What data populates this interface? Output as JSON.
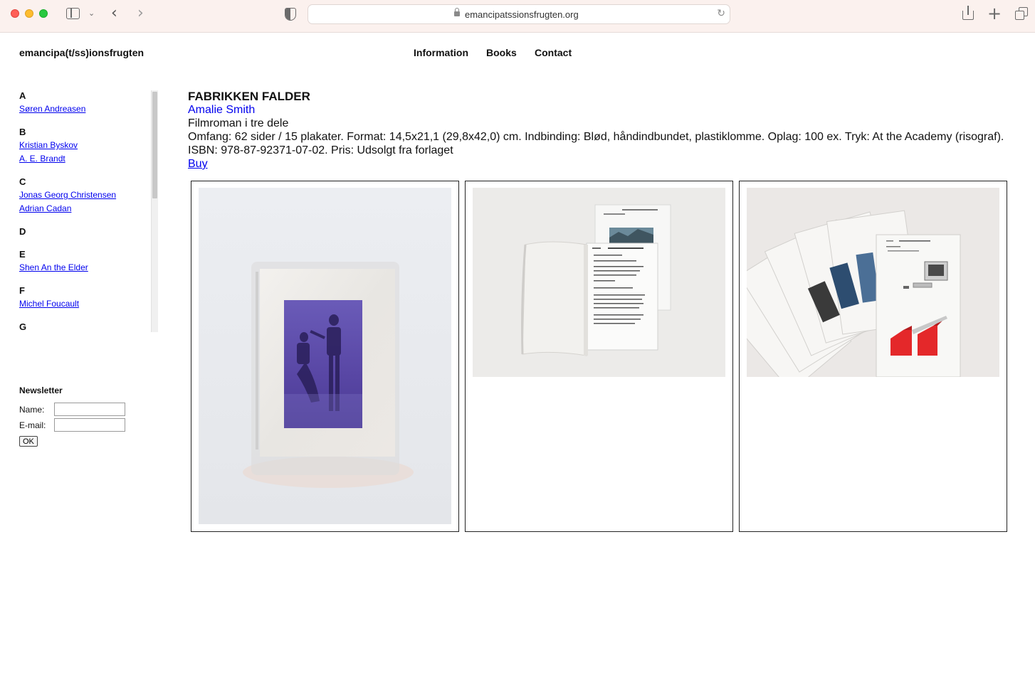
{
  "browser": {
    "url": "emancipatssionsfrugten.org"
  },
  "site": {
    "title": "emancipa(t/ss)ionsfrugten",
    "nav": [
      "Information",
      "Books",
      "Contact"
    ]
  },
  "index": {
    "groups": [
      {
        "letter": "A",
        "authors": [
          "Søren Andreasen"
        ]
      },
      {
        "letter": "B",
        "authors": [
          "Kristian Byskov",
          "A. E. Brandt"
        ]
      },
      {
        "letter": "C",
        "authors": [
          "Jonas Georg Christensen",
          "Adrian Cadan"
        ]
      },
      {
        "letter": "D",
        "authors": []
      },
      {
        "letter": "E",
        "authors": [
          "Shen An the Elder"
        ]
      },
      {
        "letter": "F",
        "authors": [
          "Michel Foucault"
        ]
      },
      {
        "letter": "G",
        "authors": []
      }
    ]
  },
  "newsletter": {
    "title": "Newsletter",
    "name_label": "Name:",
    "email_label": "E-mail:",
    "name_value": "",
    "email_value": "",
    "ok_label": "OK"
  },
  "book": {
    "title": "FABRIKKEN FALDER",
    "author": "Amalie Smith",
    "subtitle": "Filmroman i tre dele",
    "details": "Omfang: 62 sider / 15 plakater. Format: 14,5x21,1 (29,8x42,0) cm. Indbinding: Blød, håndindbundet, plastiklomme. Oplag: 100 ex. Tryk: At the Academy (risograf).",
    "isbn_price": "ISBN: 978-87-92371-07-02. Pris: Udsolgt fra forlaget",
    "buy_label": "Buy"
  },
  "colors": {
    "link": "#0000ee",
    "chrome_bg": "#fbf1ee",
    "photo_purple": "#5b48a8",
    "photo_red": "#e4282a"
  }
}
